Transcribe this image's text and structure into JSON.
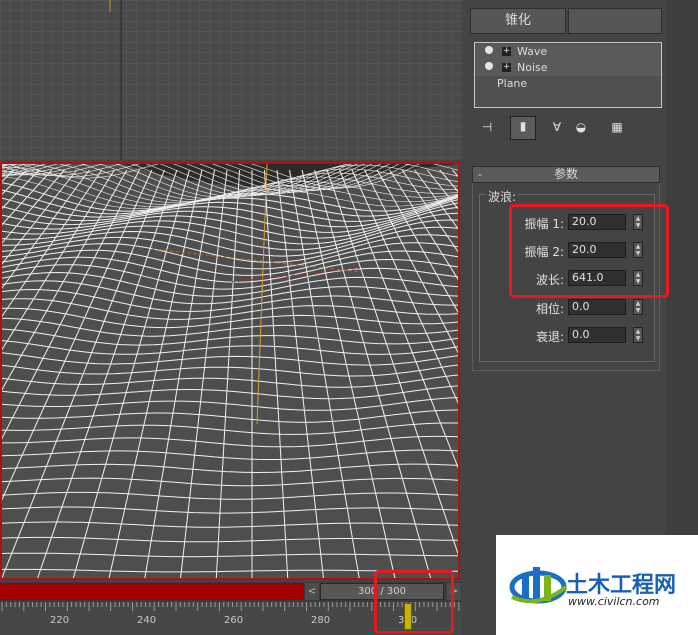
{
  "panel": {
    "modifier_button_label": "锥化",
    "stack": [
      {
        "label": "Wave",
        "has_bulb": true,
        "has_expand": true
      },
      {
        "label": "Noise",
        "has_bulb": true,
        "has_expand": true
      },
      {
        "label": "Plane",
        "has_bulb": false,
        "has_expand": false
      }
    ],
    "toolbar_icons": [
      "pin-stack-icon",
      "show-end-result-icon",
      "make-unique-icon",
      "remove-modifier-icon",
      "configure-modifier-sets-icon"
    ],
    "rollout": {
      "collapse_symbol": "-",
      "title": "参数",
      "group_title": "波浪:",
      "params": [
        {
          "label": "振幅 1:",
          "value": "20.0"
        },
        {
          "label": "振幅 2:",
          "value": "20.0"
        },
        {
          "label": "波长:",
          "value": "641.0"
        },
        {
          "label": "相位:",
          "value": "0.0"
        },
        {
          "label": "衰退:",
          "value": "0.0"
        }
      ]
    }
  },
  "timeline": {
    "slider_text": "300 / 300",
    "left_arrow": "<",
    "right_arrow": ">",
    "tick_labels": [
      "220",
      "240",
      "260",
      "280",
      "300"
    ],
    "current_frame": 300,
    "total_frames": 300
  },
  "watermark": {
    "title": "土木工程网",
    "url": "www.civilcn.com"
  },
  "colors": {
    "active_viewport_border": "#b01010",
    "highlight_box": "#e8181e",
    "time_marker": "#c8b400",
    "watermark_blue": "#1a6fc4",
    "watermark_green": "#7ab51d"
  }
}
